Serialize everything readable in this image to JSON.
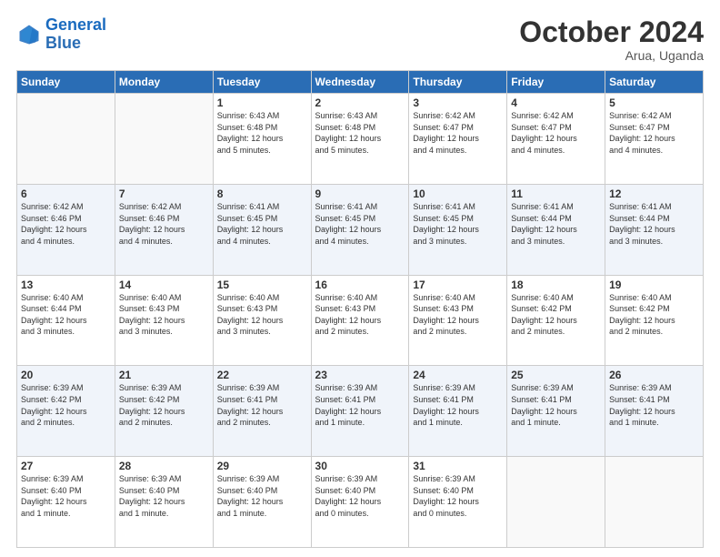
{
  "header": {
    "logo_line1": "General",
    "logo_line2": "Blue",
    "month": "October 2024",
    "location": "Arua, Uganda"
  },
  "weekdays": [
    "Sunday",
    "Monday",
    "Tuesday",
    "Wednesday",
    "Thursday",
    "Friday",
    "Saturday"
  ],
  "weeks": [
    [
      {
        "day": "",
        "info": ""
      },
      {
        "day": "",
        "info": ""
      },
      {
        "day": "1",
        "info": "Sunrise: 6:43 AM\nSunset: 6:48 PM\nDaylight: 12 hours\nand 5 minutes."
      },
      {
        "day": "2",
        "info": "Sunrise: 6:43 AM\nSunset: 6:48 PM\nDaylight: 12 hours\nand 5 minutes."
      },
      {
        "day": "3",
        "info": "Sunrise: 6:42 AM\nSunset: 6:47 PM\nDaylight: 12 hours\nand 4 minutes."
      },
      {
        "day": "4",
        "info": "Sunrise: 6:42 AM\nSunset: 6:47 PM\nDaylight: 12 hours\nand 4 minutes."
      },
      {
        "day": "5",
        "info": "Sunrise: 6:42 AM\nSunset: 6:47 PM\nDaylight: 12 hours\nand 4 minutes."
      }
    ],
    [
      {
        "day": "6",
        "info": "Sunrise: 6:42 AM\nSunset: 6:46 PM\nDaylight: 12 hours\nand 4 minutes."
      },
      {
        "day": "7",
        "info": "Sunrise: 6:42 AM\nSunset: 6:46 PM\nDaylight: 12 hours\nand 4 minutes."
      },
      {
        "day": "8",
        "info": "Sunrise: 6:41 AM\nSunset: 6:45 PM\nDaylight: 12 hours\nand 4 minutes."
      },
      {
        "day": "9",
        "info": "Sunrise: 6:41 AM\nSunset: 6:45 PM\nDaylight: 12 hours\nand 4 minutes."
      },
      {
        "day": "10",
        "info": "Sunrise: 6:41 AM\nSunset: 6:45 PM\nDaylight: 12 hours\nand 3 minutes."
      },
      {
        "day": "11",
        "info": "Sunrise: 6:41 AM\nSunset: 6:44 PM\nDaylight: 12 hours\nand 3 minutes."
      },
      {
        "day": "12",
        "info": "Sunrise: 6:41 AM\nSunset: 6:44 PM\nDaylight: 12 hours\nand 3 minutes."
      }
    ],
    [
      {
        "day": "13",
        "info": "Sunrise: 6:40 AM\nSunset: 6:44 PM\nDaylight: 12 hours\nand 3 minutes."
      },
      {
        "day": "14",
        "info": "Sunrise: 6:40 AM\nSunset: 6:43 PM\nDaylight: 12 hours\nand 3 minutes."
      },
      {
        "day": "15",
        "info": "Sunrise: 6:40 AM\nSunset: 6:43 PM\nDaylight: 12 hours\nand 3 minutes."
      },
      {
        "day": "16",
        "info": "Sunrise: 6:40 AM\nSunset: 6:43 PM\nDaylight: 12 hours\nand 2 minutes."
      },
      {
        "day": "17",
        "info": "Sunrise: 6:40 AM\nSunset: 6:43 PM\nDaylight: 12 hours\nand 2 minutes."
      },
      {
        "day": "18",
        "info": "Sunrise: 6:40 AM\nSunset: 6:42 PM\nDaylight: 12 hours\nand 2 minutes."
      },
      {
        "day": "19",
        "info": "Sunrise: 6:40 AM\nSunset: 6:42 PM\nDaylight: 12 hours\nand 2 minutes."
      }
    ],
    [
      {
        "day": "20",
        "info": "Sunrise: 6:39 AM\nSunset: 6:42 PM\nDaylight: 12 hours\nand 2 minutes."
      },
      {
        "day": "21",
        "info": "Sunrise: 6:39 AM\nSunset: 6:42 PM\nDaylight: 12 hours\nand 2 minutes."
      },
      {
        "day": "22",
        "info": "Sunrise: 6:39 AM\nSunset: 6:41 PM\nDaylight: 12 hours\nand 2 minutes."
      },
      {
        "day": "23",
        "info": "Sunrise: 6:39 AM\nSunset: 6:41 PM\nDaylight: 12 hours\nand 1 minute."
      },
      {
        "day": "24",
        "info": "Sunrise: 6:39 AM\nSunset: 6:41 PM\nDaylight: 12 hours\nand 1 minute."
      },
      {
        "day": "25",
        "info": "Sunrise: 6:39 AM\nSunset: 6:41 PM\nDaylight: 12 hours\nand 1 minute."
      },
      {
        "day": "26",
        "info": "Sunrise: 6:39 AM\nSunset: 6:41 PM\nDaylight: 12 hours\nand 1 minute."
      }
    ],
    [
      {
        "day": "27",
        "info": "Sunrise: 6:39 AM\nSunset: 6:40 PM\nDaylight: 12 hours\nand 1 minute."
      },
      {
        "day": "28",
        "info": "Sunrise: 6:39 AM\nSunset: 6:40 PM\nDaylight: 12 hours\nand 1 minute."
      },
      {
        "day": "29",
        "info": "Sunrise: 6:39 AM\nSunset: 6:40 PM\nDaylight: 12 hours\nand 1 minute."
      },
      {
        "day": "30",
        "info": "Sunrise: 6:39 AM\nSunset: 6:40 PM\nDaylight: 12 hours\nand 0 minutes."
      },
      {
        "day": "31",
        "info": "Sunrise: 6:39 AM\nSunset: 6:40 PM\nDaylight: 12 hours\nand 0 minutes."
      },
      {
        "day": "",
        "info": ""
      },
      {
        "day": "",
        "info": ""
      }
    ]
  ]
}
